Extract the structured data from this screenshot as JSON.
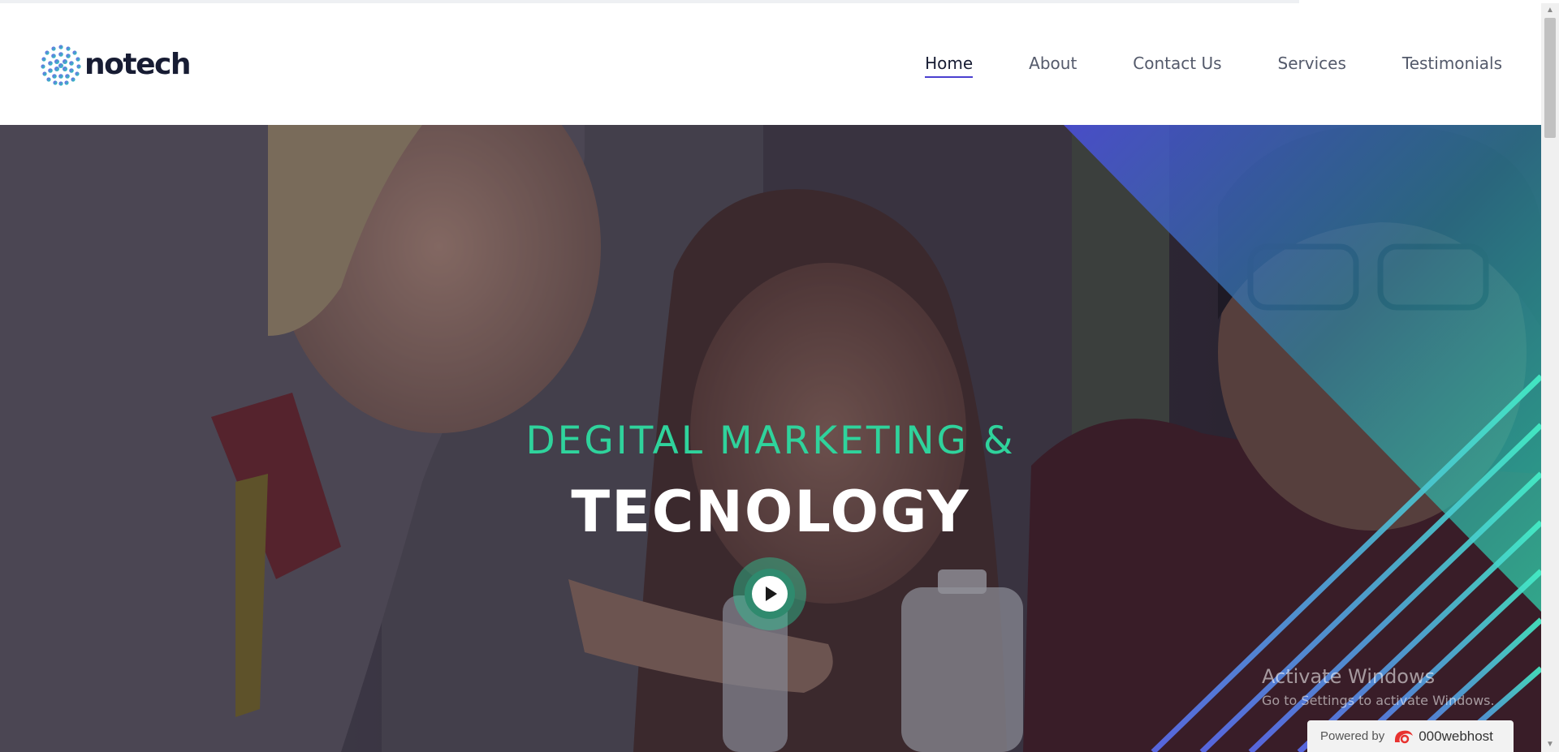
{
  "brand": {
    "logo_text": "notech",
    "logo_icon": "dotted-globe-icon"
  },
  "nav": {
    "items": [
      {
        "label": "Home",
        "active": true
      },
      {
        "label": "About",
        "active": false
      },
      {
        "label": "Contact Us",
        "active": false
      },
      {
        "label": "Services",
        "active": false
      },
      {
        "label": "Testimonials",
        "active": false
      }
    ]
  },
  "hero": {
    "subtitle": "DEGITAL MARKETING &",
    "title": "TECNOLOGY",
    "play_icon": "play-icon"
  },
  "watermark": {
    "line1": "Activate Windows",
    "line2": "Go to Settings to activate Windows."
  },
  "powered_badge": {
    "prefix": "Powered by",
    "brand": "000webhost"
  },
  "colors": {
    "accent_green": "#2fd39c",
    "nav_underline": "#4a3fcf",
    "title_dark": "#171c33",
    "hero_gradient_blue": "#4b4fe0",
    "hero_gradient_teal": "#2fe0b4"
  }
}
